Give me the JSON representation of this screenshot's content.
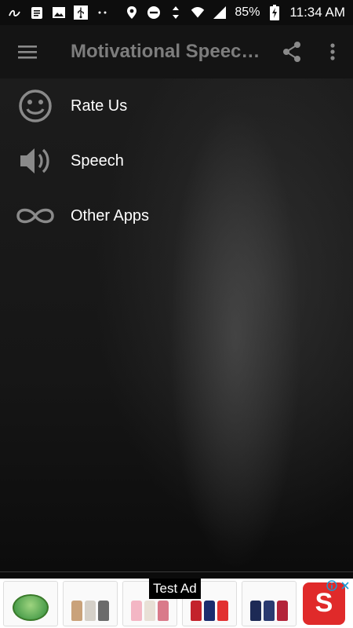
{
  "status_bar": {
    "battery": "85%",
    "time": "11:34 AM",
    "icons": [
      "notification-a-icon",
      "clipboard-icon",
      "image-icon",
      "usb-icon",
      "dots-icon",
      "location-icon",
      "dnd-icon",
      "data-arrows-icon",
      "wifi-icon",
      "signal-icon",
      "battery-charging-icon"
    ]
  },
  "toolbar": {
    "title": "Motivational Speeches",
    "menu_icon": "hamburger-menu-icon",
    "share_icon": "share-icon",
    "overflow_icon": "more-vert-icon"
  },
  "menu": {
    "items": [
      {
        "label": "Rate Us",
        "icon": "smiley-face-icon"
      },
      {
        "label": "Speech",
        "icon": "speaker-icon"
      },
      {
        "label": "Other Apps",
        "icon": "infinity-icon"
      }
    ]
  },
  "ad": {
    "label": "Test Ad"
  },
  "colors": {
    "toolbar_bg": "#141414",
    "title_text": "#7d7d7d",
    "icon_grey": "#8a8a8a",
    "ad_logo": "#e02a2a"
  }
}
